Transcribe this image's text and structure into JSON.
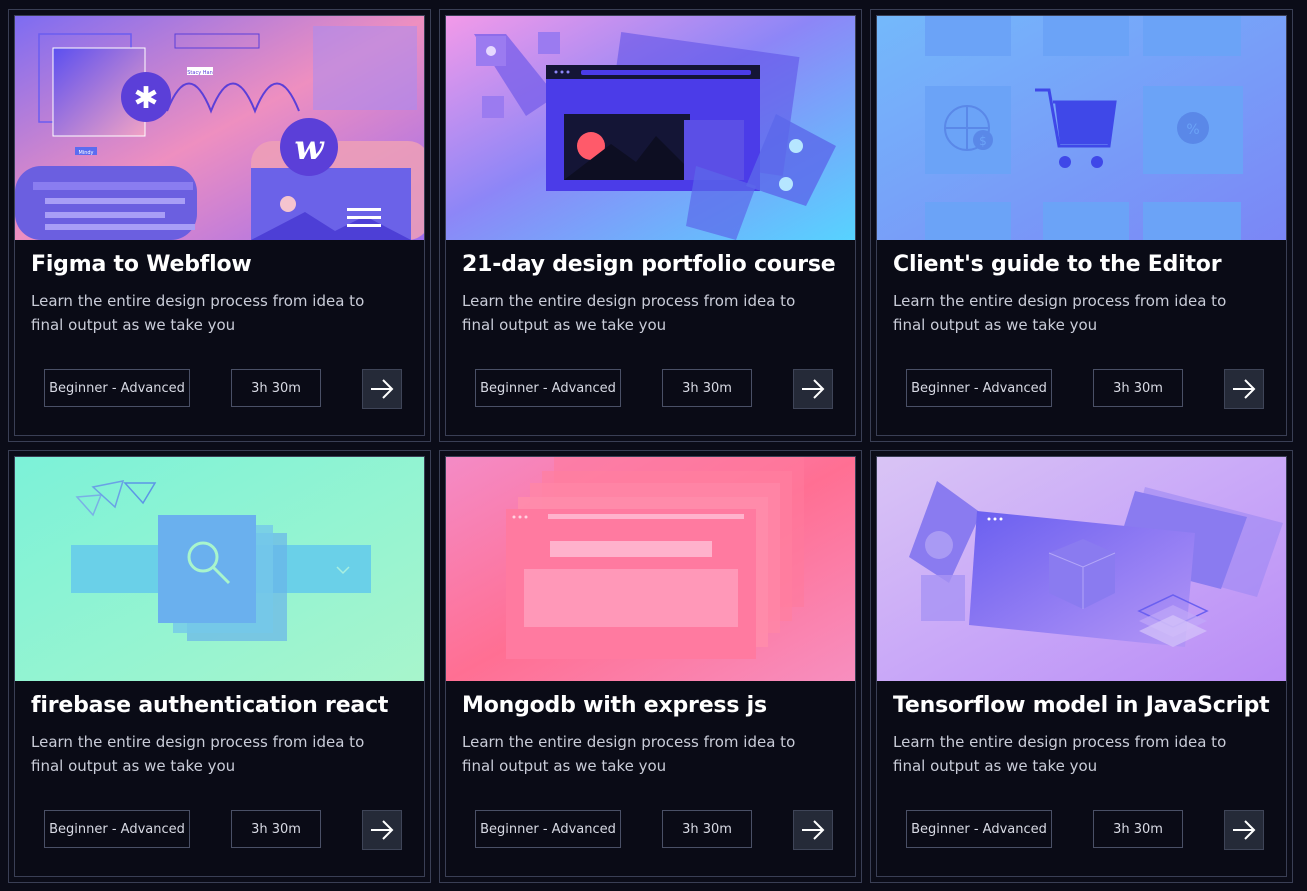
{
  "courses": [
    {
      "title": "Figma to Webflow",
      "description": "Learn the entire design process from idea to final output as we take you",
      "level": "Beginner - Advanced",
      "duration": "3h 30m",
      "thumbnail_icon": "figma-webflow-illustration"
    },
    {
      "title": "21-day design portfolio course",
      "description": "Learn the entire design process from idea to final output as we take you",
      "level": "Beginner - Advanced",
      "duration": "3h 30m",
      "thumbnail_icon": "browser-window-illustration"
    },
    {
      "title": "Client's guide to the Editor",
      "description": "Learn the entire design process from idea to final output as we take you",
      "level": "Beginner - Advanced",
      "duration": "3h 30m",
      "thumbnail_icon": "ecommerce-cart-illustration"
    },
    {
      "title": "firebase authentication react",
      "description": "Learn the entire design process from idea to final output as we take you",
      "level": "Beginner - Advanced",
      "duration": "3h 30m",
      "thumbnail_icon": "search-illustration"
    },
    {
      "title": "Mongodb with express js",
      "description": "Learn the entire design process from idea to final output as we take you",
      "level": "Beginner - Advanced",
      "duration": "3h 30m",
      "thumbnail_icon": "stacked-windows-illustration"
    },
    {
      "title": "Tensorflow model in JavaScript",
      "description": "Learn the entire design process from idea to final output as we take you",
      "level": "Beginner - Advanced",
      "duration": "3h 30m",
      "thumbnail_icon": "3d-cube-illustration"
    }
  ],
  "figma_thumb": {
    "tag_a": "Stacy Han",
    "tag_b": "Mindy"
  },
  "colors": {
    "background": "#0b0c18",
    "card_border": "#3a3f55",
    "chip_border": "#4a5066",
    "arrow_button": "#252a38"
  }
}
